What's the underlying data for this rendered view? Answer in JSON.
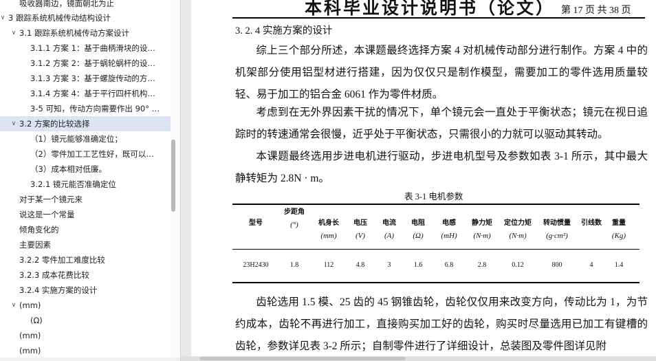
{
  "sidebar": {
    "items": [
      {
        "label": "吸收器南边，镜面朝北为止",
        "level": 3,
        "expanded": null
      },
      {
        "label": "3  跟踪系统机械传动结构设计",
        "level": 0,
        "expanded": true
      },
      {
        "label": "3.1  跟踪系统机械传动方案设计",
        "level": 1,
        "expanded": true
      },
      {
        "label": "3.1.1  方案 1：基于曲柄滑块的设…",
        "level": 2,
        "expanded": null
      },
      {
        "label": "3.1.2  方案 2：基于蜗轮蜗杆的设…",
        "level": 2,
        "expanded": null
      },
      {
        "label": "3.1.3  方案 3：基于螺旋传动的方…",
        "level": 2,
        "expanded": null
      },
      {
        "label": "3.1.4  方案 4：基于平行四杆机构…",
        "level": 2,
        "expanded": null
      },
      {
        "label": "3-5 可知，传动方向需要作出 90°  …",
        "level": 2,
        "expanded": null
      },
      {
        "label": "3.2  方案的比较选择",
        "level": 1,
        "expanded": true,
        "active": true
      },
      {
        "label": "（1）镜元能够准确定位；",
        "level": 2,
        "expanded": null
      },
      {
        "label": "（2）零件加工工艺性好，既可以…",
        "level": 2,
        "expanded": null
      },
      {
        "label": "（3）成本相对低廉。",
        "level": 2,
        "expanded": null
      },
      {
        "label": "3.2.1  镜元能否准确定位",
        "level": 2,
        "expanded": null
      },
      {
        "label": "对于某一个镜元来",
        "level": 0.7,
        "expanded": null
      },
      {
        "label": "说这是一个常量",
        "level": 0.7,
        "expanded": null
      },
      {
        "label": "倾角变化的",
        "level": 0.7,
        "expanded": null
      },
      {
        "label": "主要因素",
        "level": 0.7,
        "expanded": null
      },
      {
        "label": "3.2.2  零件加工难度比较",
        "level": 0.7,
        "expanded": null
      },
      {
        "label": "3.2.3  成本花费比较",
        "level": 0.7,
        "expanded": null
      },
      {
        "label": "3.2.4  实施方案的设计",
        "level": 0.7,
        "expanded": null
      },
      {
        "label": "(mm)",
        "level": 0.7,
        "expanded": true
      },
      {
        "label": "(Ω)",
        "level": 2,
        "expanded": null
      },
      {
        "label": "(mm)",
        "level": 0.7,
        "expanded": null
      },
      {
        "label": "(mm)",
        "level": 0.7,
        "expanded": null
      }
    ]
  },
  "page": {
    "header_title": "本科毕业设计说明书（论文）",
    "header_page": "第 17 页 共 38 页",
    "section_heading": "3. 2. 4    实施方案的设计",
    "paragraphs": [
      "综上三个部分所述，本课题最终选择方案 4 对机械传动部分进行制作。方案 4 中的机架部分使用铝型材进行搭建，因为仅仅只是制作模型，需要加工的零件选用质量较轻、易于加工的铝合金 6061 作为零件材质。",
      "考虑到在无外界因素干扰的情况下，单个镜元会一直处于平衡状态；镜元在视日追踪时的转速通常会很慢，近乎处于平衡状态，只需很小的力就可以驱动其转动。",
      "本课题最终选用步进电机进行驱动，步进电机型号及参数如表 3-1 所示，其中最大静转矩为 2.8N · m。",
      "齿轮选用 1.5 模、25 齿的 45 钢锥齿轮，齿轮仅仅用来改变方向，传动比为 1，为节约成本，齿轮不再进行加工，直接购买加工好的齿轮，购买时尽量选用已加工有键槽的齿轮，参数详见表 3-2 所示；自制零件进行了详细设计，总装图及零件图详见附"
    ],
    "table": {
      "caption": "表 3-1  电机参数",
      "headers": [
        {
          "name": "型号",
          "unit": ""
        },
        {
          "name": "步距角",
          "unit": "(°)"
        },
        {
          "name": "机身长",
          "unit": "(mm)"
        },
        {
          "name": "电压",
          "unit": "(V)"
        },
        {
          "name": "电流",
          "unit": "(A)"
        },
        {
          "name": "电阻",
          "unit": "(Ω)"
        },
        {
          "name": "电感",
          "unit": "(mH)"
        },
        {
          "name": "静力矩",
          "unit": "(N·m)"
        },
        {
          "name": "定位力矩",
          "unit": "(N·m)"
        },
        {
          "name": "转动惯量",
          "unit": "(g·cm²)"
        },
        {
          "name": "引线数",
          "unit": ""
        },
        {
          "name": "重量",
          "unit": "(Kg)"
        }
      ],
      "row": [
        "23H2430",
        "1.8",
        "112",
        "4.8",
        "3",
        "1.6",
        "6.8",
        "2.8",
        "0.12",
        "800",
        "4",
        "1.4"
      ]
    }
  }
}
